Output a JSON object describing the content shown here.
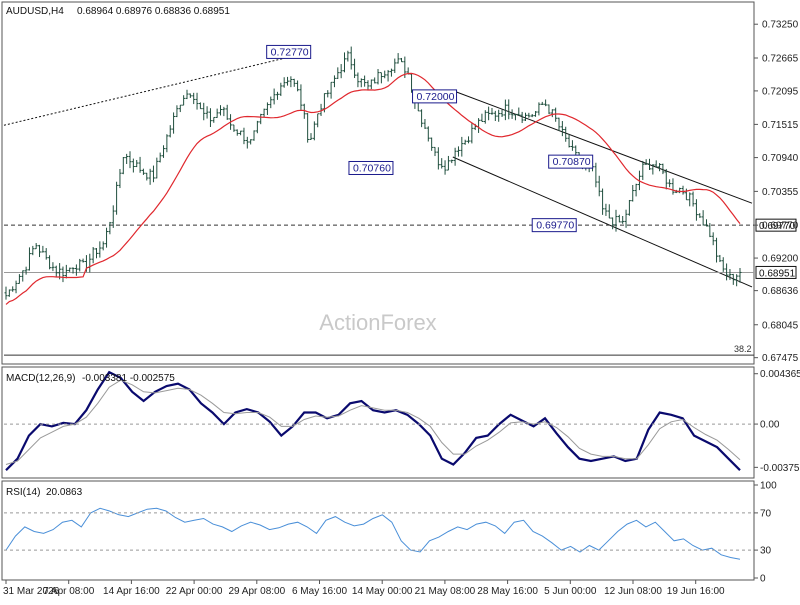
{
  "header": {
    "symbol": "AUDUSD,H4",
    "ohlc": "0.68964 0.68976 0.68836 0.68951"
  },
  "watermark": "ActionForex",
  "colors": {
    "candle": "#1f4e3d",
    "ma": "#e0282e",
    "macd_line": "#0a0a6e",
    "macd_signal": "#9a9a9a",
    "rsi": "#4a8fd8",
    "level_box": "#1a1a8c",
    "grid": "#d8d8d8",
    "axis_text": "#222222"
  },
  "chart_data": [
    {
      "type": "candlestick",
      "panel": "price",
      "ylim": [
        0.674,
        0.736
      ],
      "y_ticks": [
        "0.73250",
        "0.72665",
        "0.72095",
        "0.71515",
        "0.70940",
        "0.70355",
        "0.69770",
        "0.69200",
        "0.68636",
        "0.68045",
        "0.67475"
      ],
      "x_ticks": [
        "31 Mar 2026",
        "7 Apr 08:00",
        "14 Apr 16:00",
        "22 Apr 00:00",
        "29 Apr 08:00",
        "6 May 16:00",
        "14 May 00:00",
        "21 May 08:00",
        "28 May 16:00",
        "5 Jun 00:00",
        "12 Jun 08:00",
        "19 Jun 16:00"
      ],
      "close_path": [
        0.6855,
        0.688,
        0.6905,
        0.6945,
        0.692,
        0.69,
        0.6895,
        0.691,
        0.6905,
        0.693,
        0.6945,
        0.701,
        0.71,
        0.7085,
        0.707,
        0.706,
        0.711,
        0.7155,
        0.72,
        0.721,
        0.717,
        0.716,
        0.718,
        0.715,
        0.7135,
        0.712,
        0.716,
        0.719,
        0.722,
        0.7235,
        0.72,
        0.712,
        0.718,
        0.721,
        0.7245,
        0.727,
        0.723,
        0.7215,
        0.7235,
        0.725,
        0.726,
        0.7245,
        0.718,
        0.714,
        0.709,
        0.708,
        0.711,
        0.7125,
        0.715,
        0.7165,
        0.717,
        0.7178,
        0.7175,
        0.7165,
        0.717,
        0.719,
        0.7165,
        0.713,
        0.71,
        0.708,
        0.707,
        0.7,
        0.6985,
        0.698,
        0.703,
        0.7075,
        0.7085,
        0.707,
        0.704,
        0.704,
        0.702,
        0.699,
        0.696,
        0.6905,
        0.6885,
        0.6895
      ],
      "high_labels": [
        {
          "text": "0.72770",
          "x": 0.41,
          "y": 0.7277
        },
        {
          "text": "0.72000",
          "x": 0.605,
          "y": 0.72
        },
        {
          "text": "0.70870",
          "x": 0.787,
          "y": 0.7087
        }
      ],
      "low_labels": [
        {
          "text": "0.70760",
          "x": 0.52,
          "y": 0.7076
        },
        {
          "text": "0.69770",
          "x": 0.765,
          "y": 0.6977
        }
      ],
      "levels": [
        {
          "name": "support",
          "value": 0.6977,
          "style": "dashed",
          "label": "0.69770"
        },
        {
          "name": "last",
          "value": 0.68951,
          "style": "solid",
          "label": "0.68951"
        },
        {
          "name": "fib",
          "value": 0.6752,
          "style": "solid",
          "label": "38.2"
        }
      ],
      "trendlines": [
        {
          "style": "dotted",
          "from": [
            0.0,
            0.715
          ],
          "to": [
            0.41,
            0.7277
          ]
        },
        {
          "style": "solid",
          "from": [
            0.6,
            0.721
          ],
          "to": [
            1.0,
            0.7015
          ]
        },
        {
          "style": "solid",
          "from": [
            0.6,
            0.7095
          ],
          "to": [
            1.0,
            0.687
          ]
        }
      ],
      "last_price": 0.68951
    },
    {
      "type": "line",
      "panel": "macd",
      "title": "MACD(12,26,9)",
      "value_text": "-0.003381 -0.002575",
      "ylim": [
        -0.0045,
        0.0046
      ],
      "y_ticks": [
        "0.004365",
        "0.00",
        "-0.00375"
      ],
      "series": [
        {
          "name": "macd",
          "values": [
            -0.004,
            -0.003,
            -0.001,
            0.0,
            -0.0002,
            0.0001,
            0.0,
            0.0012,
            0.003,
            0.0045,
            0.004,
            0.0028,
            0.002,
            0.0028,
            0.0033,
            0.0035,
            0.003,
            0.0018,
            0.001,
            0.0,
            0.001,
            0.0013,
            0.001,
            0.0002,
            -0.001,
            -0.0002,
            0.001,
            0.001,
            0.0005,
            0.0008,
            0.0018,
            0.002,
            0.0012,
            0.001,
            0.0012,
            0.0008,
            0.0,
            -0.001,
            -0.003,
            -0.0035,
            -0.0025,
            -0.0012,
            -0.001,
            0.0,
            0.0008,
            0.0003,
            -0.0002,
            0.0005,
            -0.0008,
            -0.002,
            -0.003,
            -0.0032,
            -0.003,
            -0.0028,
            -0.0032,
            -0.003,
            -0.0005,
            0.001,
            0.0008,
            0.0005,
            -0.001,
            -0.0015,
            -0.002,
            -0.003,
            -0.004
          ]
        },
        {
          "name": "signal",
          "values": [
            -0.0035,
            -0.0032,
            -0.0022,
            -0.0012,
            -0.0007,
            -0.0002,
            0.0,
            0.0006,
            0.0018,
            0.0032,
            0.0038,
            0.0034,
            0.0028,
            0.0027,
            0.0029,
            0.0031,
            0.003,
            0.0025,
            0.0018,
            0.001,
            0.0009,
            0.001,
            0.001,
            0.0006,
            -0.0002,
            -0.0002,
            0.0004,
            0.0007,
            0.0006,
            0.0007,
            0.0012,
            0.0016,
            0.0014,
            0.0012,
            0.0012,
            0.001,
            0.0005,
            -0.0002,
            -0.0016,
            -0.0026,
            -0.0026,
            -0.0019,
            -0.0014,
            -0.0007,
            0.0001,
            0.0002,
            0.0,
            0.0002,
            -0.0003,
            -0.0011,
            -0.0021,
            -0.0026,
            -0.0028,
            -0.0028,
            -0.003,
            -0.003,
            -0.0018,
            -0.0004,
            0.0002,
            0.0004,
            -0.0003,
            -0.0009,
            -0.0014,
            -0.0022,
            -0.0031
          ]
        }
      ]
    },
    {
      "type": "line",
      "panel": "rsi",
      "title": "RSI(14)",
      "value_text": "20.0863",
      "ylim": [
        0,
        100
      ],
      "y_ticks": [
        "100",
        "70",
        "30",
        "0"
      ],
      "levels": [
        70,
        30
      ],
      "series": [
        {
          "name": "rsi",
          "values": [
            30,
            45,
            55,
            50,
            48,
            52,
            60,
            62,
            55,
            70,
            75,
            72,
            68,
            66,
            70,
            74,
            75,
            72,
            65,
            60,
            62,
            64,
            58,
            55,
            50,
            56,
            60,
            57,
            52,
            54,
            58,
            60,
            55,
            48,
            62,
            66,
            60,
            56,
            58,
            64,
            68,
            60,
            40,
            30,
            28,
            40,
            44,
            50,
            55,
            52,
            58,
            60,
            56,
            48,
            60,
            62,
            50,
            45,
            38,
            30,
            34,
            28,
            35,
            30,
            40,
            50,
            58,
            62,
            55,
            60,
            50,
            40,
            42,
            35,
            30,
            32,
            25,
            22,
            20.0863
          ]
        }
      ]
    }
  ]
}
